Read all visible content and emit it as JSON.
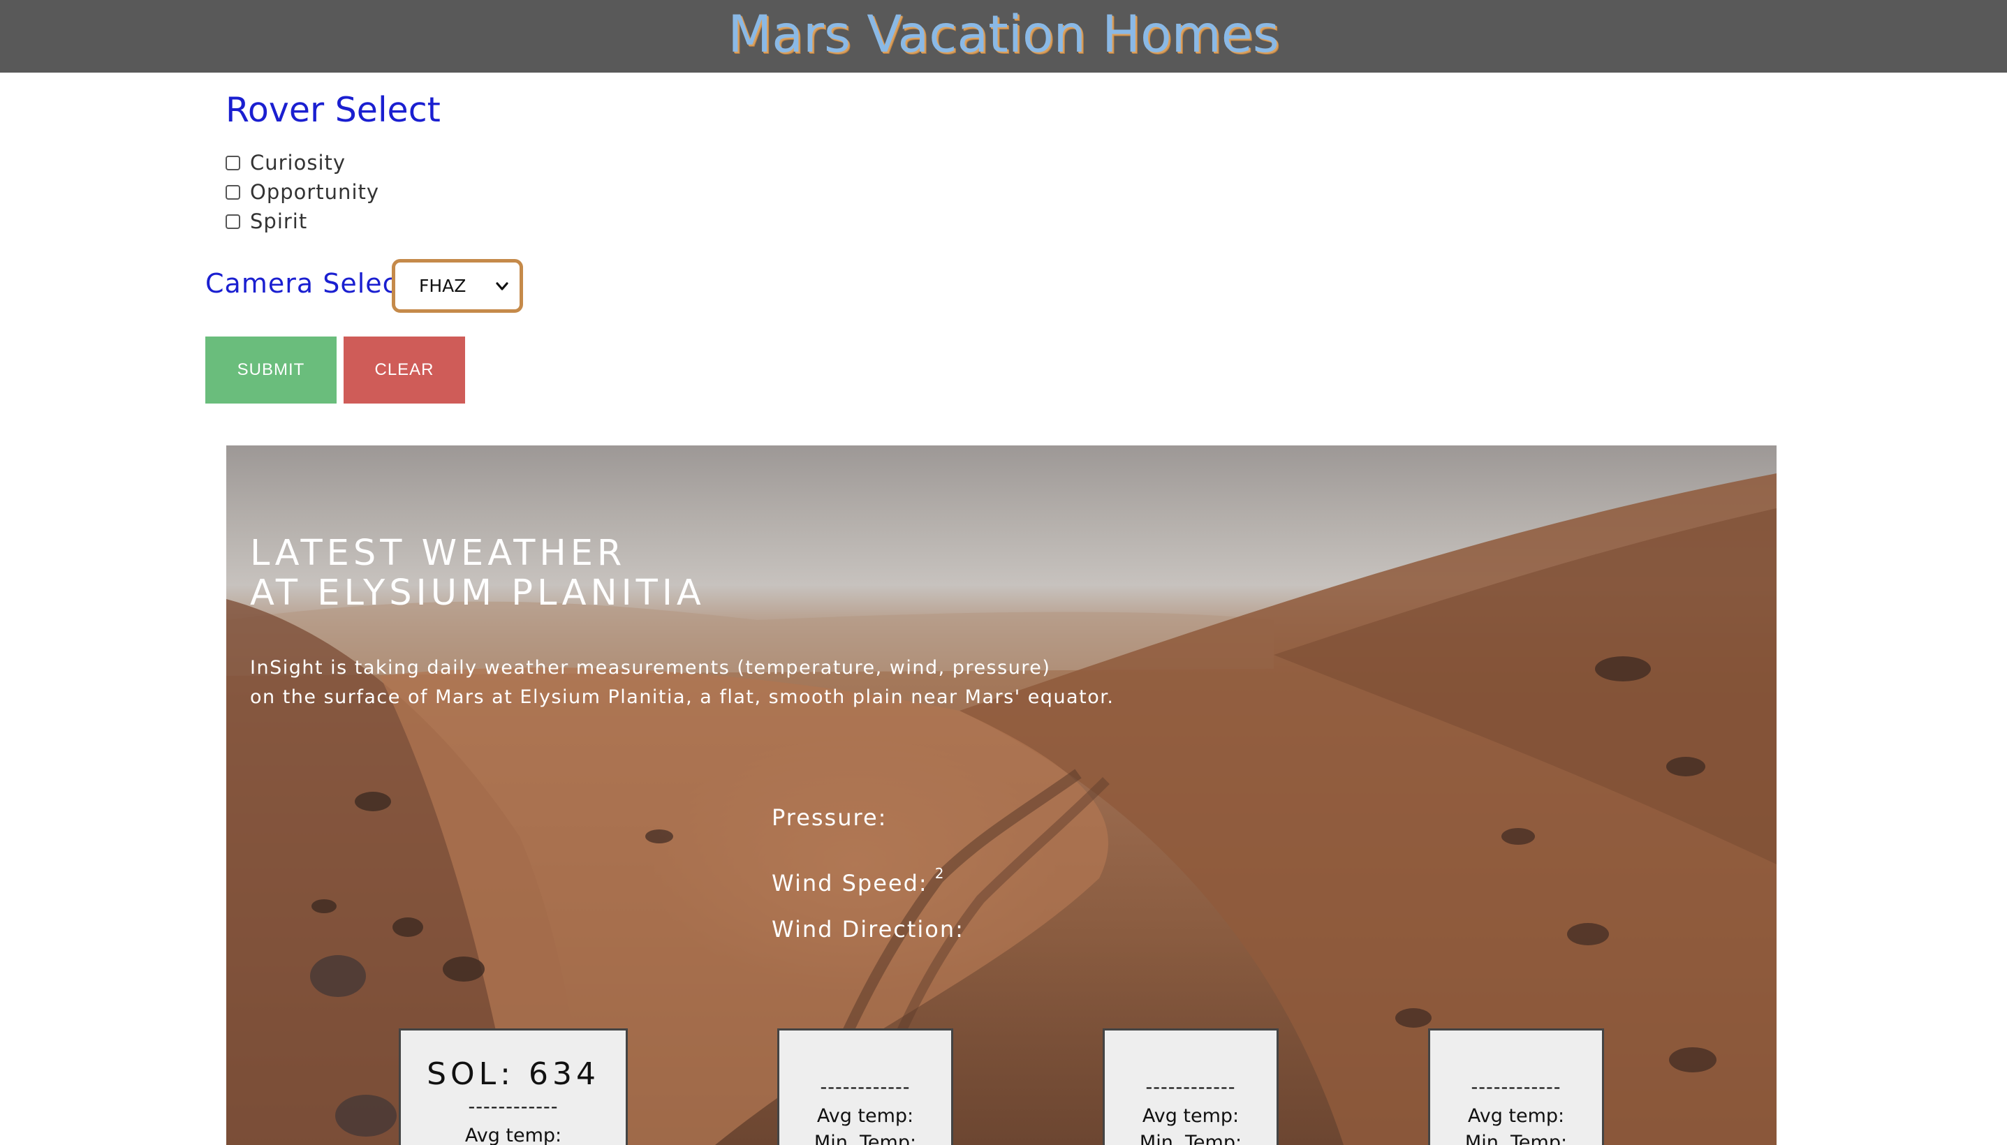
{
  "header": {
    "title": "Mars Vacation Homes"
  },
  "rover_select": {
    "heading": "Rover Select",
    "options": [
      {
        "label": "Curiosity",
        "checked": false
      },
      {
        "label": "Opportunity",
        "checked": false
      },
      {
        "label": "Spirit",
        "checked": false
      }
    ]
  },
  "camera_select": {
    "label": "Camera Select",
    "selected": "FHAZ",
    "accent_color": "#c58a4a"
  },
  "buttons": {
    "submit": "SUBMIT",
    "clear": "CLEAR",
    "submit_color": "#6abd7c",
    "clear_color": "#cf5c58"
  },
  "weather": {
    "title_line1": "LATEST WEATHER",
    "title_line2": "AT ELYSIUM PLANITIA",
    "desc_line1": "InSight is taking daily weather measurements (temperature, wind, pressure)",
    "desc_line2": "on the surface of Mars at Elysium Planitia, a flat, smooth plain near Mars' equator.",
    "pressure_label": "Pressure:",
    "wind_speed_label": "Wind Speed:",
    "wind_speed_sup": "2",
    "wind_direction_label": "Wind Direction:"
  },
  "sol_cards": [
    {
      "title": "SOL: 634",
      "dash": "------------",
      "line1": "Avg temp:"
    },
    {
      "dash": "------------",
      "line1": "Avg temp:",
      "line2": "Min. Temp:"
    },
    {
      "dash": "------------",
      "line1": "Avg temp:",
      "line2": "Min. Temp:"
    },
    {
      "dash": "------------",
      "line1": "Avg temp:",
      "line2": "Min. Temp:"
    }
  ]
}
